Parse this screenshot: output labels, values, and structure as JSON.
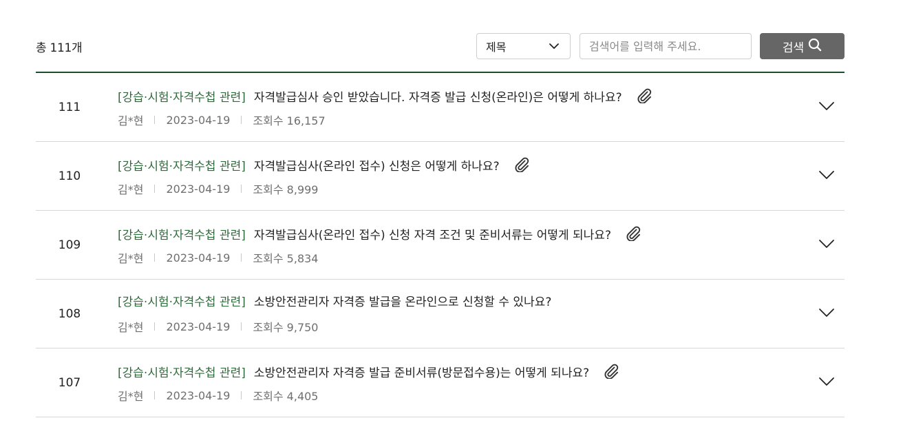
{
  "summary": {
    "total": "총 111개"
  },
  "search": {
    "field_selected": "제목",
    "placeholder": "검색어를 입력해 주세요.",
    "button_label": "검색"
  },
  "icons": {
    "dropdown": "chevron-down-icon",
    "search": "search-icon",
    "attachment": "paperclip-icon",
    "expand": "chevron-down-icon"
  },
  "colors": {
    "category": "#2e6b3a",
    "header_rule": "#1d4d2a",
    "search_button": "#666666"
  },
  "posts": [
    {
      "num": "111",
      "category": "[강습·시험·자격수첩 관련]",
      "title": "자격발급심사 승인 받았습니다. 자격증 발급 신청(온라인)은 어떻게 하나요?",
      "attachment": true,
      "author": "김*현",
      "date": "2023-04-19",
      "views": "조회수 16,157"
    },
    {
      "num": "110",
      "category": "[강습·시험·자격수첩 관련]",
      "title": "자격발급심사(온라인 접수) 신청은 어떻게 하나요?",
      "attachment": true,
      "author": "김*현",
      "date": "2023-04-19",
      "views": "조회수 8,999"
    },
    {
      "num": "109",
      "category": "[강습·시험·자격수첩 관련]",
      "title": "자격발급심사(온라인 접수) 신청 자격 조건 및 준비서류는 어떻게 되나요?",
      "attachment": true,
      "author": "김*현",
      "date": "2023-04-19",
      "views": "조회수 5,834"
    },
    {
      "num": "108",
      "category": "[강습·시험·자격수첩 관련]",
      "title": "소방안전관리자 자격증 발급을 온라인으로 신청할 수 있나요?",
      "attachment": false,
      "author": "김*현",
      "date": "2023-04-19",
      "views": "조회수 9,750"
    },
    {
      "num": "107",
      "category": "[강습·시험·자격수첩 관련]",
      "title": "소방안전관리자 자격증 발급 준비서류(방문접수용)는 어떻게 되나요?",
      "attachment": true,
      "author": "김*현",
      "date": "2023-04-19",
      "views": "조회수 4,405"
    }
  ]
}
